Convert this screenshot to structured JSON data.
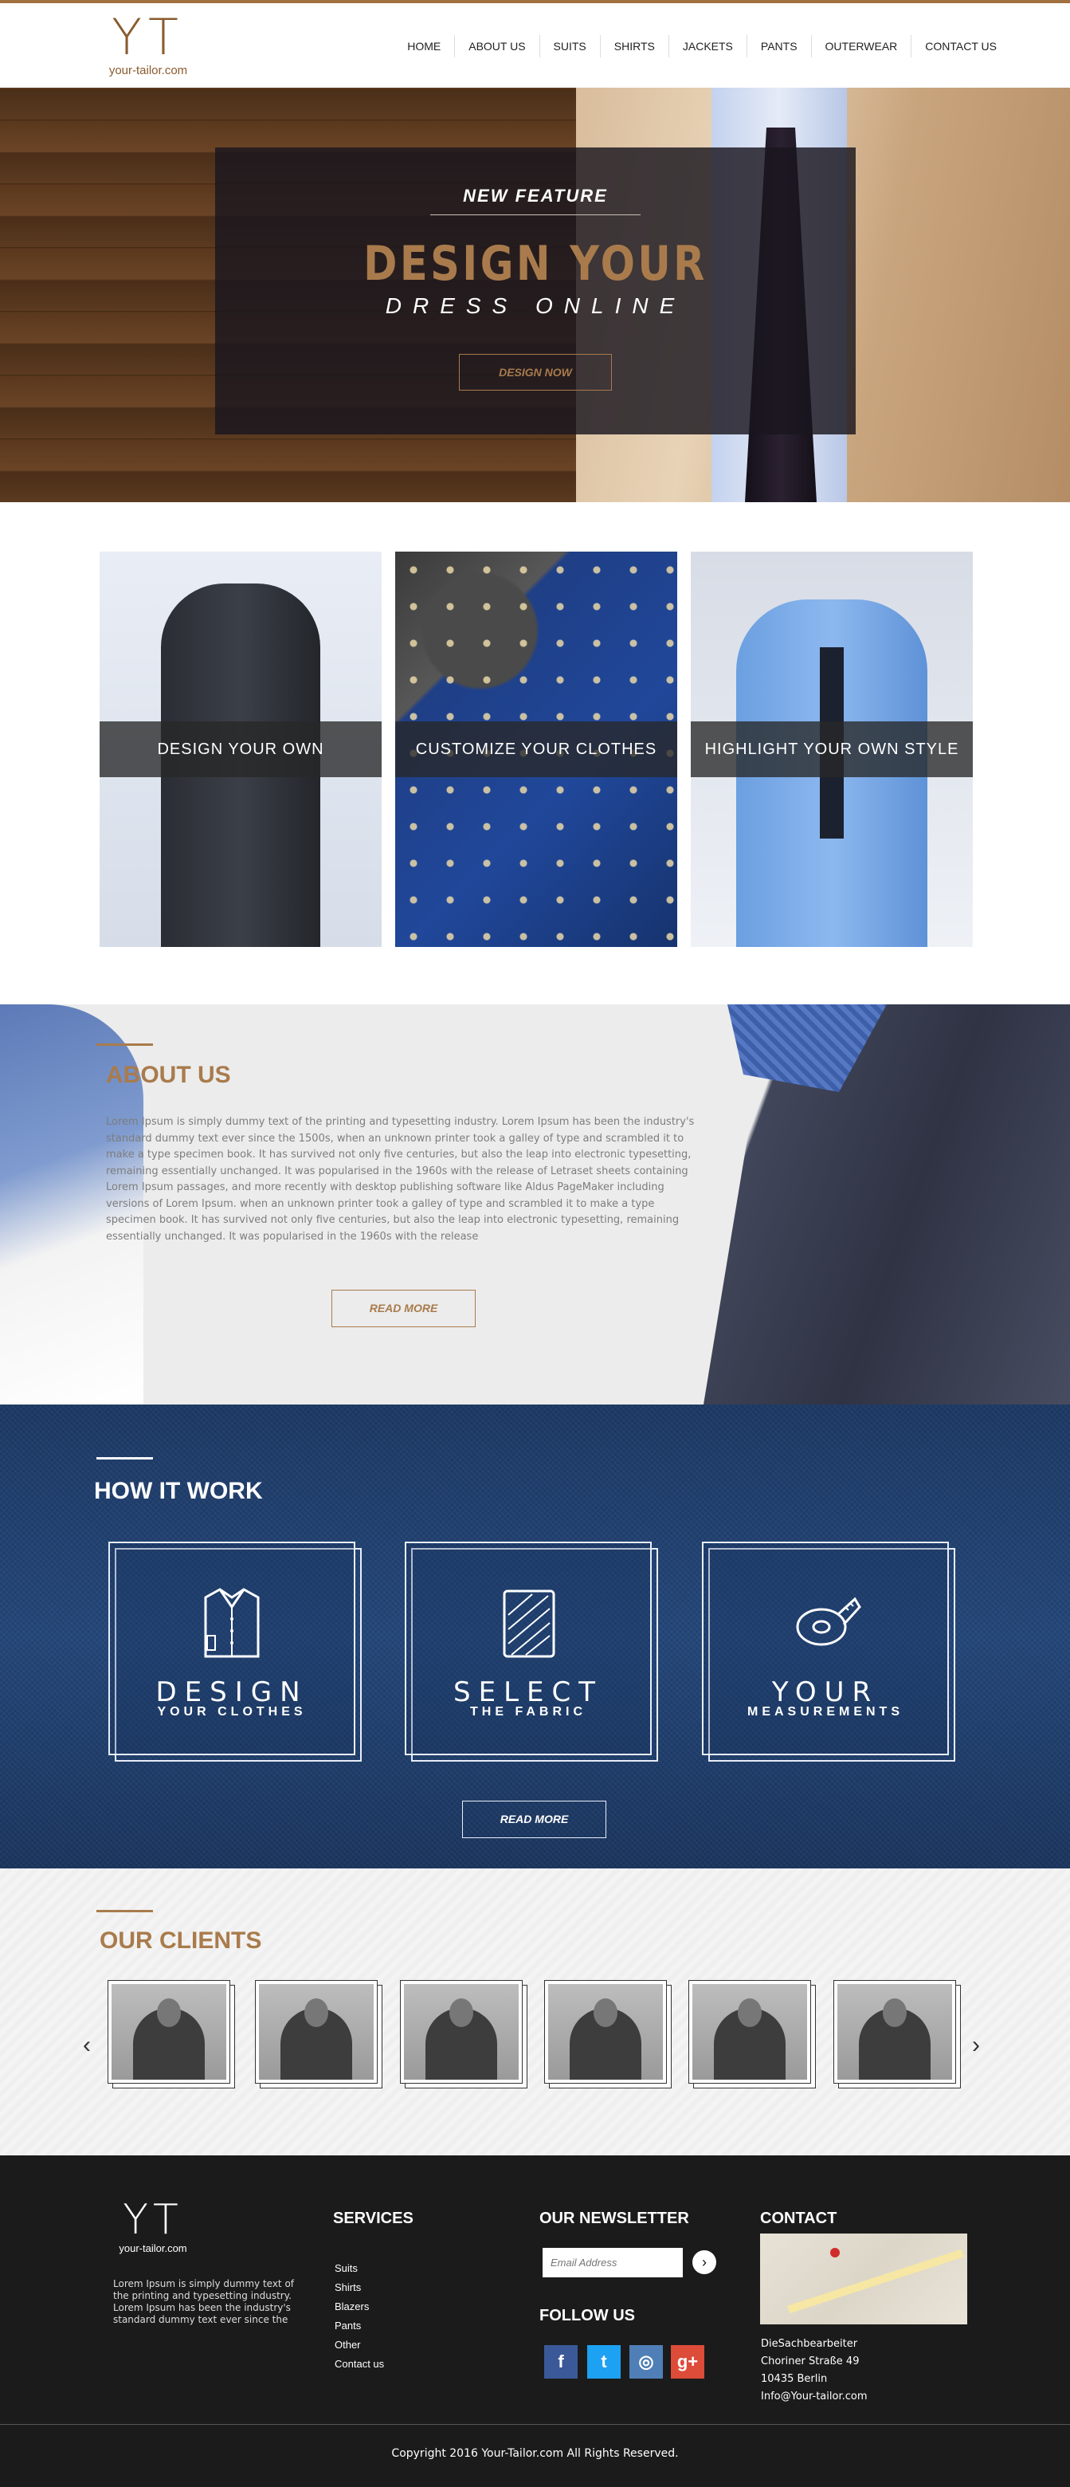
{
  "header": {
    "logo_mark": "YT",
    "logo_text": "your-tailor.com",
    "nav": [
      "HOME",
      "ABOUT US",
      "SUITS",
      "SHIRTS",
      "JACKETS",
      "PANTS",
      "OUTERWEAR",
      "CONTACT US"
    ]
  },
  "hero": {
    "kicker": "NEW FEATURE",
    "title": "DESIGN YOUR",
    "subtitle": "DRESS ONLINE",
    "button": "DESIGN NOW"
  },
  "features": {
    "cards": [
      {
        "label": "DESIGN YOUR OWN"
      },
      {
        "label": "CUSTOMIZE YOUR CLOTHES"
      },
      {
        "label": "HIGHLIGHT YOUR OWN STYLE"
      }
    ]
  },
  "about": {
    "title": "ABOUT US",
    "text": "Lorem Ipsum is simply dummy text of the printing and typesetting industry. Lorem Ipsum has been the industry's standard dummy text ever since the 1500s, when an unknown printer took a galley of type and scrambled it to make a type specimen book. It has survived not only five centuries, but also the leap into electronic typesetting, remaining essentially unchanged. It was popularised in the 1960s with the release of Letraset sheets containing Lorem Ipsum passages, and more recently with desktop publishing software like Aldus PageMaker including versions of Lorem Ipsum.  when an unknown printer took a galley of type and scrambled it to make a type specimen book. It has survived not only five centuries, but also the leap into electronic typesetting, remaining essentially unchanged. It was popularised in the 1960s with the release",
    "button": "READ MORE"
  },
  "how": {
    "title": "HOW IT WORK",
    "steps": [
      {
        "title": "DESIGN",
        "sub": "YOUR CLOTHES",
        "icon": "shirt-icon"
      },
      {
        "title": "SELECT",
        "sub": "THE FABRIC",
        "icon": "fabric-icon"
      },
      {
        "title": "YOUR",
        "sub": "MEASUREMENTS",
        "icon": "measuring-tape-icon"
      }
    ],
    "button": "READ MORE"
  },
  "clients": {
    "title": "OUR CLIENTS",
    "prev": "‹",
    "next": "›"
  },
  "footer": {
    "logo_mark": "YT",
    "logo_text": "your-tailor.com",
    "about": "Lorem Ipsum is simply dummy text of the printing and typesetting industry. Lorem Ipsum has been the industry's standard dummy text ever since the",
    "services_heading": "SERVICES",
    "services": [
      "Suits",
      "Shirts",
      "Blazers",
      "Pants",
      "Other",
      "Contact us"
    ],
    "newsletter_heading": "OUR NEWSLETTER",
    "newsletter_placeholder": "Email Address",
    "newsletter_submit": "›",
    "follow_heading": "FOLLOW US",
    "social": [
      {
        "name": "facebook-icon",
        "glyph": "f"
      },
      {
        "name": "twitter-icon",
        "glyph": "t"
      },
      {
        "name": "instagram-icon",
        "glyph": "◎"
      },
      {
        "name": "google-plus-icon",
        "glyph": "g+"
      }
    ],
    "contact_heading": "CONTACT",
    "contact_lines": [
      "DieSachbearbeiter",
      "Choriner Straße 49",
      "10435 Berlin",
      "Info@Your-tailor.com"
    ],
    "copyright": "Copyright 2016 Your-Tailor.com All Rights Reserved."
  },
  "colors": {
    "accent": "#a97b4c",
    "footer_bg": "#1b1b1b",
    "how_bg": "#1d3a66"
  }
}
